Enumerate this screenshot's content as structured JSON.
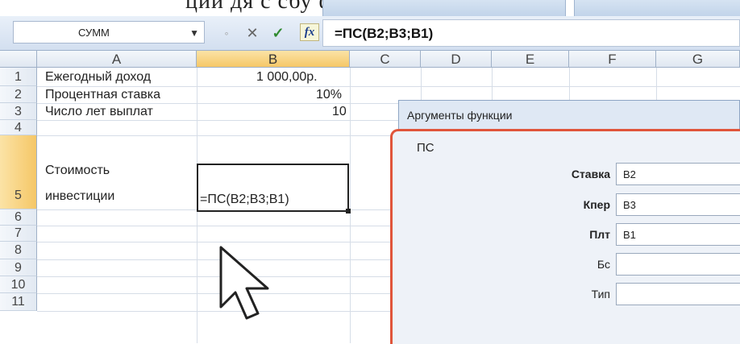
{
  "caption": {
    "text": "ции дя с сбу фун ции д (урис )"
  },
  "formula_bar": {
    "name_box": "СУММ",
    "fx_label": "fx",
    "formula": "=ПС(B2;B3;B1)"
  },
  "sheet": {
    "columns": [
      "A",
      "B",
      "C",
      "D",
      "E",
      "F",
      "G"
    ],
    "rows": [
      "1",
      "2",
      "3",
      "4",
      "5",
      "6",
      "7",
      "8",
      "9",
      "10",
      "11"
    ],
    "cells": {
      "A1": "Ежегодный доход",
      "B1": "1 000,00р.",
      "A2": "Процентная ставка",
      "B2": "10%",
      "A3": "Число лет выплат",
      "B3": "10",
      "A5_line1": "Стоимость",
      "A5_line2": "инвестиции",
      "B5": "=ПС(B2;B3;B1)"
    }
  },
  "dialog": {
    "title": "Аргументы функции",
    "function_name": "ПС",
    "args": [
      {
        "label": "Ставка",
        "value": "B2",
        "bold": true
      },
      {
        "label": "Кпер",
        "value": "B3",
        "bold": true
      },
      {
        "label": "Плт",
        "value": "B1",
        "bold": true
      },
      {
        "label": "Бс",
        "value": "",
        "bold": false
      },
      {
        "label": "Тип",
        "value": "",
        "bold": false
      }
    ]
  },
  "colors": {
    "selected_header": "#f5c767",
    "dialog_border_highlight": "#e0553b"
  }
}
